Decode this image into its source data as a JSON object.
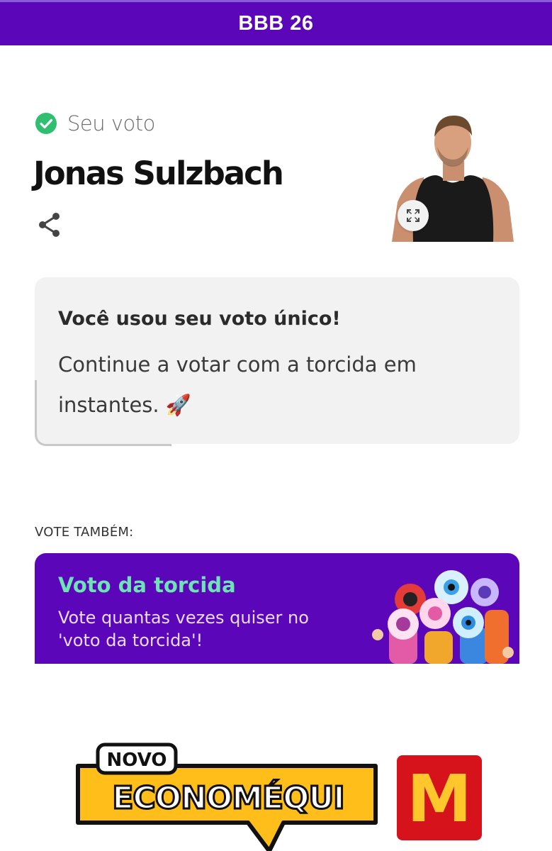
{
  "header": {
    "title": "BBB 26"
  },
  "vote": {
    "label": "Seu voto",
    "candidate_name": "Jonas Sulzbach"
  },
  "notice": {
    "title": "Você usou seu voto único!",
    "body": "Continue a votar com a torcida em instantes. 🚀"
  },
  "also_vote": {
    "label": "VOTE TAMBÉM:"
  },
  "torcida_card": {
    "title": "Voto da torcida",
    "subtitle": "Vote quantas vezes quiser no 'voto da torcida'!"
  },
  "ad": {
    "badge": "NOVO",
    "headline": "ECONOMÉQUI",
    "brand_letter": "M"
  },
  "colors": {
    "brand_purple": "#5b06b8",
    "accent_green": "#6ee3b6",
    "check_green": "#2fbf71",
    "card_bg": "#f2f2f2"
  },
  "icons": [
    "check-circle-icon",
    "share-icon",
    "expand-icon",
    "rocket-icon"
  ]
}
